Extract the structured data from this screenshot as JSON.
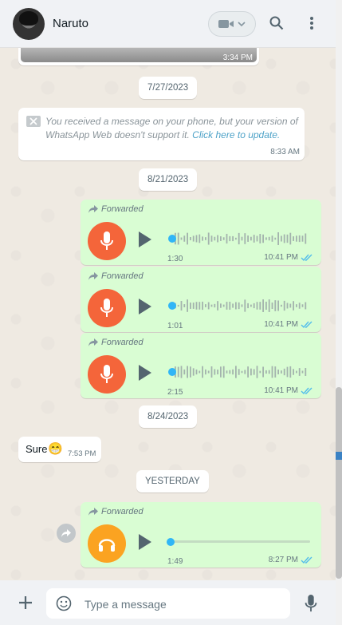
{
  "header": {
    "contact_name": "Naruto"
  },
  "top_partial": {
    "time": "3:34 PM"
  },
  "date_1": "7/27/2023",
  "unsupported": {
    "text_a": "You received a message on your phone, but your version of WhatsApp Web doesn't support it. ",
    "link": "Click here to update.",
    "time": "8:33 AM"
  },
  "date_2": "8/21/2023",
  "voice_messages": [
    {
      "forwarded": "Forwarded",
      "duration": "1:30",
      "time": "10:41 PM"
    },
    {
      "forwarded": "Forwarded",
      "duration": "1:01",
      "time": "10:41 PM"
    },
    {
      "forwarded": "Forwarded",
      "duration": "2:15",
      "time": "10:41 PM"
    }
  ],
  "date_3": "8/24/2023",
  "sure_msg": {
    "text": "Sure",
    "emoji": "😁",
    "time": "7:53 PM"
  },
  "date_4": "YESTERDAY",
  "audio_msg": {
    "forwarded": "Forwarded",
    "duration": "1:49",
    "time": "8:27 PM"
  },
  "footer": {
    "placeholder": "Type a message"
  },
  "colors": {
    "outgoing": "#d9fdd3",
    "mic": "#f4653a",
    "headphones": "#fba321",
    "progress": "#30b6f6",
    "ticks": "#53bdeb"
  },
  "icons": [
    "video-camera-icon",
    "chevron-down-icon",
    "search-icon",
    "menu-icon",
    "forward-arrow-icon",
    "microphone-icon",
    "headphones-icon",
    "play-icon",
    "double-check-icon",
    "plus-icon",
    "emoji-icon",
    "message-unavailable-icon",
    "share-icon"
  ]
}
